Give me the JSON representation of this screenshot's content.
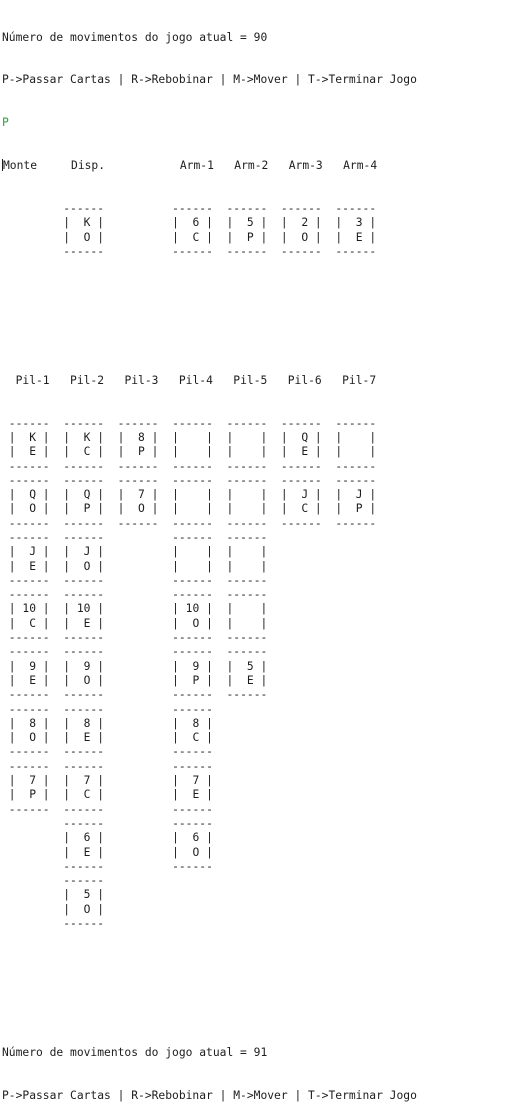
{
  "header_top": {
    "moves_line": "Número de movimentos do jogo atual = 90",
    "menu_line": "P->Passar Cartas | R->Rebobinar | M->Mover | T->Terminar Jogo",
    "user_input": "P"
  },
  "top_row": {
    "labels": [
      "Monte",
      "Disp.",
      "",
      "Arm-1",
      "Arm-2",
      "Arm-3",
      "Arm-4"
    ],
    "cards": [
      null,
      {
        "rank": "K",
        "suit": "O"
      },
      null,
      {
        "rank": "6",
        "suit": "C"
      },
      {
        "rank": "5",
        "suit": "P"
      },
      {
        "rank": "2",
        "suit": "O"
      },
      {
        "rank": "3",
        "suit": "E"
      }
    ]
  },
  "piles": {
    "labels": [
      "Pil-1",
      "Pil-2",
      "Pil-3",
      "Pil-4",
      "Pil-5",
      "Pil-6",
      "Pil-7"
    ],
    "rows": [
      [
        {
          "rank": "K",
          "suit": "E"
        },
        {
          "rank": "K",
          "suit": "C"
        },
        {
          "rank": "8",
          "suit": "P"
        },
        {
          "rank": "",
          "suit": ""
        },
        {
          "rank": "",
          "suit": ""
        },
        {
          "rank": "Q",
          "suit": "E"
        },
        {
          "rank": "",
          "suit": ""
        }
      ],
      [
        {
          "rank": "Q",
          "suit": "O"
        },
        {
          "rank": "Q",
          "suit": "P"
        },
        {
          "rank": "7",
          "suit": "O"
        },
        {
          "rank": "",
          "suit": ""
        },
        {
          "rank": "",
          "suit": ""
        },
        {
          "rank": "J",
          "suit": "C"
        },
        {
          "rank": "J",
          "suit": "P"
        }
      ],
      [
        {
          "rank": "J",
          "suit": "E"
        },
        {
          "rank": "J",
          "suit": "O"
        },
        null,
        {
          "rank": "",
          "suit": ""
        },
        {
          "rank": "",
          "suit": ""
        },
        null,
        null
      ],
      [
        {
          "rank": "10",
          "suit": "C"
        },
        {
          "rank": "10",
          "suit": "E"
        },
        null,
        {
          "rank": "10",
          "suit": "O"
        },
        {
          "rank": "",
          "suit": ""
        },
        null,
        null
      ],
      [
        {
          "rank": "9",
          "suit": "E"
        },
        {
          "rank": "9",
          "suit": "O"
        },
        null,
        {
          "rank": "9",
          "suit": "P"
        },
        {
          "rank": "5",
          "suit": "E"
        },
        null,
        null
      ],
      [
        {
          "rank": "8",
          "suit": "O"
        },
        {
          "rank": "8",
          "suit": "E"
        },
        null,
        {
          "rank": "8",
          "suit": "C"
        },
        null,
        null,
        null
      ],
      [
        {
          "rank": "7",
          "suit": "P"
        },
        {
          "rank": "7",
          "suit": "C"
        },
        null,
        {
          "rank": "7",
          "suit": "E"
        },
        null,
        null,
        null
      ],
      [
        null,
        {
          "rank": "6",
          "suit": "E"
        },
        null,
        {
          "rank": "6",
          "suit": "O"
        },
        null,
        null,
        null
      ],
      [
        null,
        {
          "rank": "5",
          "suit": "O"
        },
        null,
        null,
        null,
        null,
        null
      ]
    ]
  },
  "header_bottom": {
    "moves_line": "Número de movimentos do jogo atual = 91",
    "menu_line": "P->Passar Cartas | R->Rebobinar | M->Mover | T->Terminar Jogo"
  }
}
